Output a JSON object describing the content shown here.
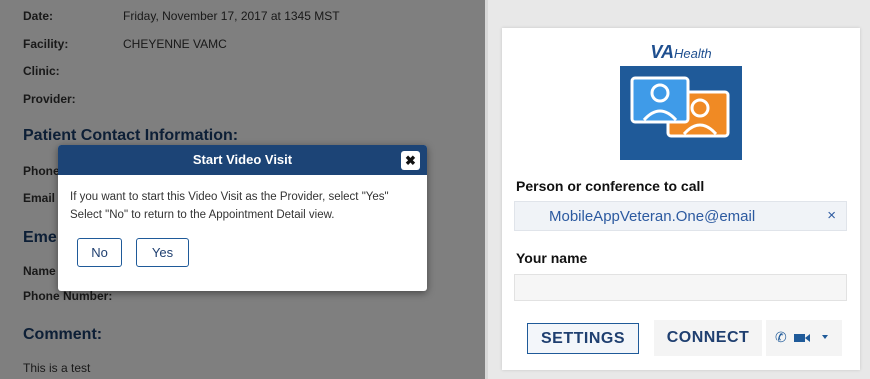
{
  "appointment": {
    "date_label": "Date:",
    "date_value": "Friday, November 17, 2017 at 1345 MST",
    "facility_label": "Facility:",
    "facility_value": "CHEYENNE VAMC",
    "clinic_label": "Clinic:",
    "provider_label": "Provider:",
    "patient_contact_heading": "Patient Contact Information:",
    "phone_label": "Phone",
    "email_label": "Email",
    "emergency_heading": "Eme",
    "name_label": "Name",
    "phone_number_label": "Phone Number:",
    "comment_heading": "Comment:",
    "comment_value": "This is a test"
  },
  "modal": {
    "title": "Start Video Visit",
    "close_glyph": "✖",
    "message_line1": "If you want to start this Video Visit as the Provider, select \"Yes\"",
    "message_line2": "Select \"No\" to return to the Appointment Detail view.",
    "no_label": "No",
    "yes_label": "Yes"
  },
  "call_panel": {
    "logo_va": "VA",
    "logo_health": "Health",
    "callee_label": "Person or conference to call",
    "callee_value": "MobileAppVeteran.One@email",
    "clear_glyph": "×",
    "name_label": "Your name",
    "name_value": "",
    "settings_label": "SETTINGS",
    "connect_label": "CONNECT",
    "phone_icon": "phone-icon",
    "video_icon": "video-camera-icon"
  },
  "colors": {
    "brand_navy": "#1c4476",
    "brand_blue": "#1f5a99",
    "link_blue": "#2c5aa0",
    "logo_orange": "#f08a24"
  }
}
